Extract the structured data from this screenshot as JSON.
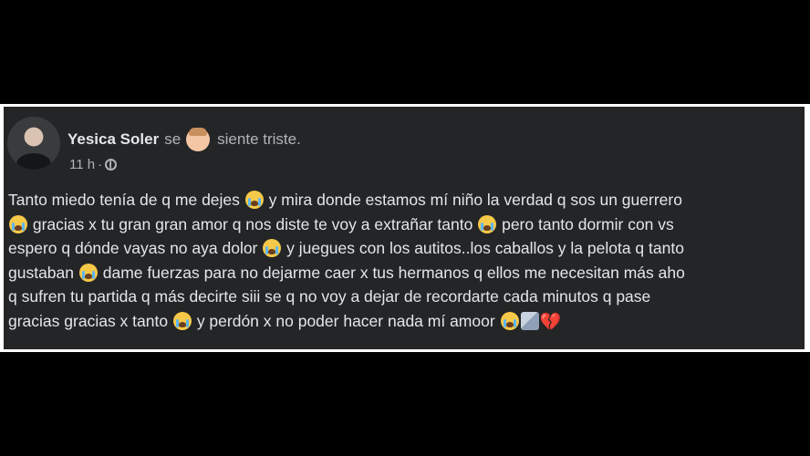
{
  "post": {
    "author": "Yesica Soler",
    "feeling_prefix": "se",
    "feeling_text": "siente triste.",
    "time": "11 h",
    "separator": "·",
    "privacy_icon": "globe-icon",
    "feeling_icon": "sad-face-emoji",
    "lines": [
      {
        "parts": [
          "Tanto miedo tenía de q me dejes ",
          " y mira donde estamos mí niño la verdad q sos un guerrero"
        ]
      },
      {
        "parts": [
          "",
          " gracias x tu gran gran amor q nos diste te voy a extrañar tanto ",
          " pero tanto dormir con vs"
        ]
      },
      {
        "parts": [
          "espero q dónde vayas no aya dolor ",
          " y juegues con los autitos..los caballos y la pelota q tanto"
        ]
      },
      {
        "parts": [
          "gustaban ",
          " dame fuerzas para no dejarme caer x tus hermanos q ellos me necesitan más aho"
        ]
      },
      {
        "parts": [
          "q sufren tu partida q más decirte siii se q no voy a dejar de recordarte cada minutos q pase"
        ]
      },
      {
        "parts": [
          "gracias gracias x tanto ",
          " y perdón x no poder hacer nada mí amoor "
        ]
      }
    ],
    "broken_heart": "💔"
  }
}
